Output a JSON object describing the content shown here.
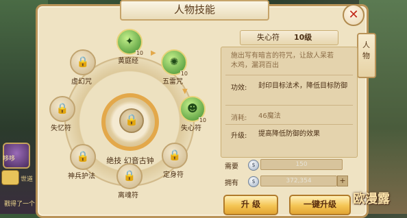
{
  "title": "人物技能",
  "side_tab": "人物",
  "sidebar": {
    "name": "哆哆",
    "chat_text": "世道",
    "chat_text2": "戳得了一个"
  },
  "center_skill": {
    "label": "绝技  幻音古钟"
  },
  "skills": [
    {
      "name": "黄庭经",
      "level": "10",
      "unlocked": true
    },
    {
      "name": "五雷咒",
      "level": "10",
      "unlocked": true
    },
    {
      "name": "失心符",
      "level": "10",
      "unlocked": true
    },
    {
      "name": "定身符",
      "level": "",
      "unlocked": false
    },
    {
      "name": "离魂符",
      "level": "",
      "unlocked": false
    },
    {
      "name": "神兵护法",
      "level": "",
      "unlocked": false
    },
    {
      "name": "失忆符",
      "level": "",
      "unlocked": false
    },
    {
      "name": "虚幻咒",
      "level": "",
      "unlocked": false
    }
  ],
  "detail": {
    "name": "失心符",
    "level": "10级",
    "description": "施出写有暗言的符咒，让敌人呆若木鸡，漏洞百出",
    "effect_label": "功效:",
    "effect": "封印目标法术，降低目标防御",
    "cost_label": "消耗:",
    "cost": "46魔法",
    "upgrade_label": "升级:",
    "upgrade": "提高降低防御的效果"
  },
  "resources": {
    "need_label": "需要",
    "need_value": "150",
    "have_label": "拥有",
    "have_value": "372,354"
  },
  "buttons": {
    "upgrade": "升 级",
    "upgrade_all": "一键升级"
  },
  "watermark": "欧漫露",
  "colors": {
    "accent": "#e3a84a",
    "unlocked_green": "#3f8b2e",
    "close_red": "#c22a1a"
  }
}
